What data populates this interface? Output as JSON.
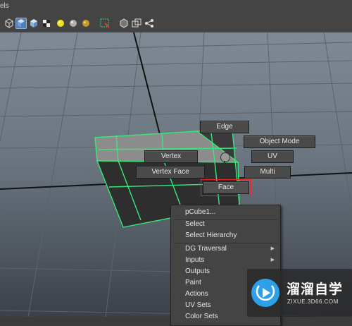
{
  "menubar": {
    "label": "els"
  },
  "toolbar": {
    "icons": [
      "wireframe-cube-icon",
      "shaded-cube-icon",
      "textured-cube-icon",
      "checker-icon",
      "yellow-light-icon",
      "grey-sphere-icon",
      "gold-sphere-icon",
      "select-region-icon",
      "box-icon",
      "copy-icon",
      "share-icon"
    ]
  },
  "marking_menu": {
    "edge": "Edge",
    "object_mode": "Object Mode",
    "vertex": "Vertex",
    "uv": "UV",
    "vertex_face": "Vertex Face",
    "multi": "Multi",
    "face": "Face"
  },
  "context_menu": {
    "items": [
      {
        "label": "pCube1..."
      },
      {
        "label": "Select"
      },
      {
        "label": "Select Hierarchy"
      },
      {
        "label": "DG Traversal"
      },
      {
        "label": "Inputs"
      },
      {
        "label": "Outputs"
      },
      {
        "label": "Paint"
      },
      {
        "label": "Actions"
      },
      {
        "label": "UV Sets"
      },
      {
        "label": "Color Sets"
      }
    ]
  },
  "watermark": {
    "name": "溜溜自学",
    "url": "ZIXUE.3D66.COM",
    "color": "#2da0e8"
  },
  "colors": {
    "selection": "#39e87a",
    "highlight": "#e22222"
  }
}
